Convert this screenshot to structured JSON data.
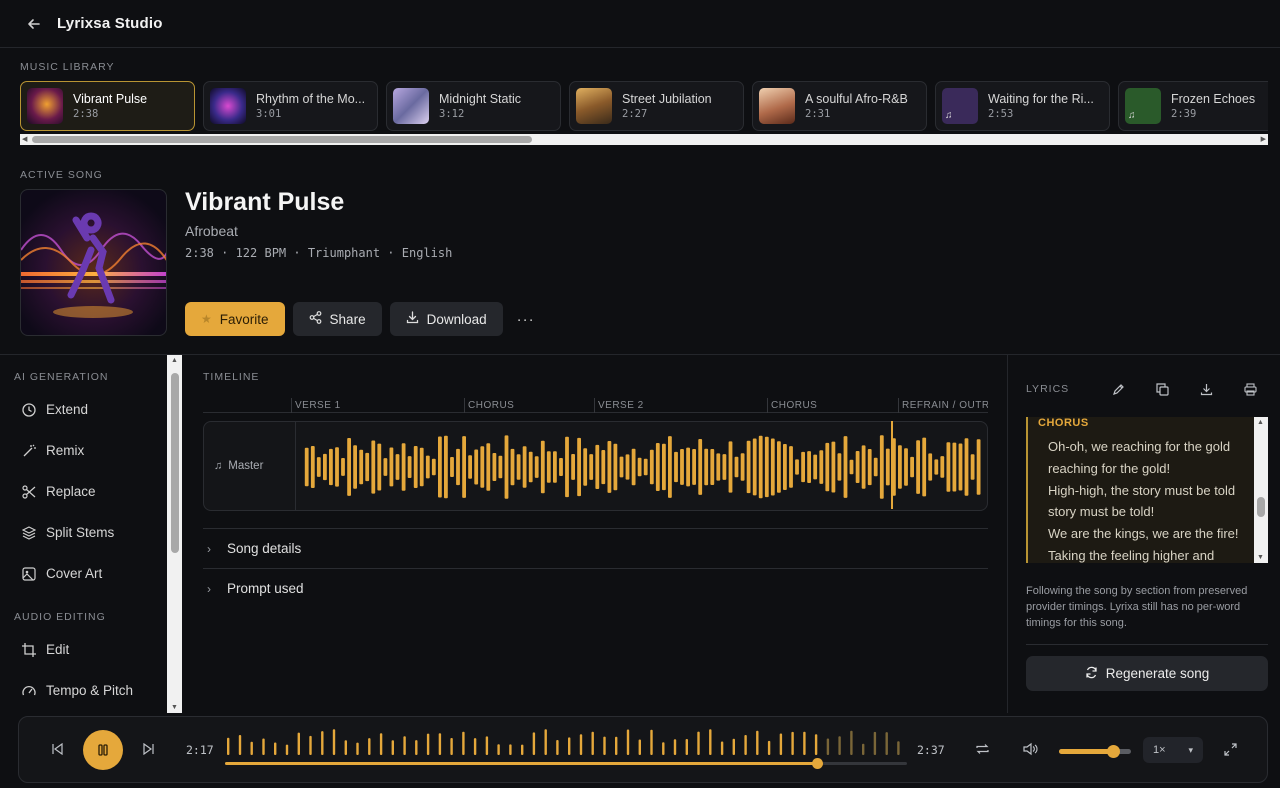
{
  "header": {
    "title": "Lyrixsa Studio"
  },
  "library": {
    "label": "MUSIC LIBRARY",
    "items": [
      {
        "title": "Vibrant Pulse",
        "duration": "2:38",
        "active": true
      },
      {
        "title": "Rhythm of the Mo...",
        "duration": "3:01"
      },
      {
        "title": "Midnight Static",
        "duration": "3:12"
      },
      {
        "title": "Street Jubilation",
        "duration": "2:27"
      },
      {
        "title": "A soulful Afro-R&B",
        "duration": "2:31"
      },
      {
        "title": "Waiting for the Ri...",
        "duration": "2:53"
      },
      {
        "title": "Frozen Echoes",
        "duration": "2:39"
      }
    ]
  },
  "active_song": {
    "label": "ACTIVE SONG",
    "title": "Vibrant Pulse",
    "genre": "Afrobeat",
    "meta": "2:38 · 122 BPM · Triumphant · English",
    "actions": {
      "favorite": "Favorite",
      "share": "Share",
      "download": "Download",
      "more": "···"
    }
  },
  "sidebar": {
    "ai_label": "AI GENERATION",
    "ai_items": [
      "Extend",
      "Remix",
      "Replace",
      "Split Stems",
      "Cover Art"
    ],
    "audio_label": "AUDIO EDITING",
    "audio_items": [
      "Edit",
      "Tempo & Pitch"
    ]
  },
  "timeline": {
    "label": "TIMELINE",
    "sections": [
      "VERSE 1",
      "CHORUS",
      "VERSE 2",
      "CHORUS",
      "REFRAIN / OUTRO"
    ],
    "track_name": "Master",
    "expanders": [
      "Song details",
      "Prompt used"
    ]
  },
  "lyrics": {
    "label": "LYRICS",
    "section": "CHORUS",
    "lines": [
      "Oh-oh, we reaching for the gold",
      "reaching for the gold!",
      "High-high, the story must be told",
      "story must be told!",
      "We are the kings, we are the fire!",
      "Taking the feeling higher and"
    ],
    "note": "Following the song by section from preserved provider timings. Lyrixa still has no per-word timings for this song.",
    "regenerate": "Regenerate song"
  },
  "player": {
    "current_time": "2:17",
    "total_time": "2:37",
    "progress": 0.868,
    "volume": 0.75,
    "speed": "1×"
  },
  "colors": {
    "accent": "#e5a83b",
    "background": "#0e0f12"
  }
}
